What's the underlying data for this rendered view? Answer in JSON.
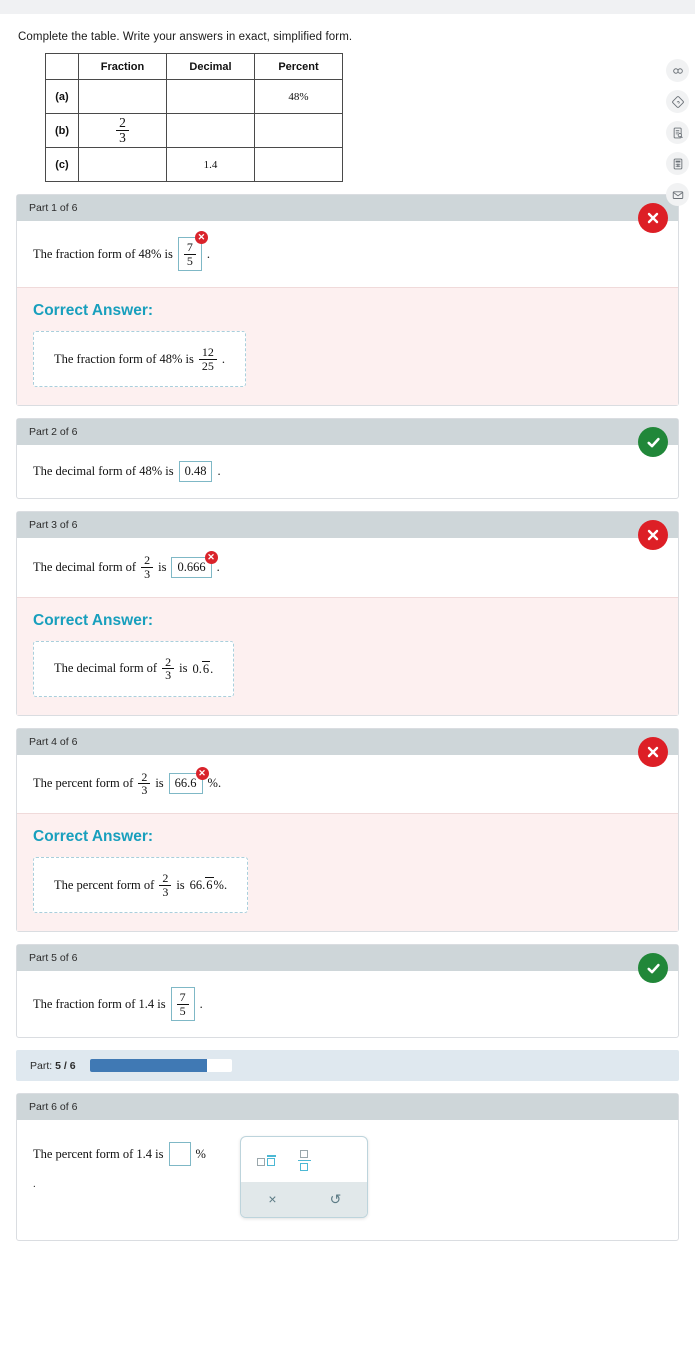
{
  "prompt": "Complete the table. Write your answers in exact, simplified form.",
  "table": {
    "headers": [
      "",
      "Fraction",
      "Decimal",
      "Percent"
    ],
    "rows": [
      {
        "label": "(a)",
        "fraction": "",
        "decimal": "",
        "percent": "48%"
      },
      {
        "label": "(b)",
        "fraction_num": "2",
        "fraction_den": "3",
        "decimal": "",
        "percent": ""
      },
      {
        "label": "(c)",
        "fraction": "",
        "decimal": "1.4",
        "percent": ""
      }
    ]
  },
  "parts": [
    {
      "header": "Part 1 of 6",
      "status": "incorrect",
      "statement_prefix": "The fraction form of 48% is",
      "statement_suffix": ".",
      "answer_num": "7",
      "answer_den": "5",
      "correct_title": "Correct Answer:",
      "correct_prefix": "The fraction form of 48% is",
      "correct_num": "12",
      "correct_den": "25",
      "correct_suffix": "."
    },
    {
      "header": "Part 2 of 6",
      "status": "correct",
      "statement_prefix": "The decimal form of 48% is",
      "statement_suffix": ".",
      "answer_value": "0.48"
    },
    {
      "header": "Part 3 of 6",
      "status": "incorrect",
      "statement_prefix": "The decimal form of",
      "statement_mid": "is",
      "frac_num": "2",
      "frac_den": "3",
      "statement_suffix": ".",
      "answer_value": "0.666",
      "correct_title": "Correct Answer:",
      "correct_prefix": "The decimal form of",
      "correct_mid": "is",
      "correct_lead": "0.",
      "correct_repeat": "6",
      "correct_suffix": "."
    },
    {
      "header": "Part 4 of 6",
      "status": "incorrect",
      "statement_prefix": "The percent form of",
      "statement_mid": "is",
      "frac_num": "2",
      "frac_den": "3",
      "statement_suffix": "%.",
      "answer_value": "66.6",
      "correct_title": "Correct Answer:",
      "correct_prefix": "The percent form of",
      "correct_mid": "is",
      "correct_lead": "66.",
      "correct_repeat": "6",
      "correct_suffix": "%."
    },
    {
      "header": "Part 5 of 6",
      "status": "correct",
      "statement_prefix": "The fraction form of 1.4 is",
      "statement_suffix": ".",
      "answer_num": "7",
      "answer_den": "5"
    },
    {
      "header": "Part 6 of 6",
      "status": "none",
      "statement_prefix": "The percent form of 1.4 is",
      "statement_suffix": "%",
      "answer_value": "",
      "trailing_dot": "."
    }
  ],
  "progress": {
    "label_prefix": "Part:",
    "current": "5 / 6",
    "percent": 83,
    "fill_color": "#4079b4"
  },
  "mathpad": {
    "keys": [
      {
        "name": "repeating-decimal-key",
        "label": "repeating-decimal-template"
      },
      {
        "name": "fraction-key",
        "label": "fraction-template"
      }
    ],
    "close_label": "×",
    "undo_label": "↺"
  },
  "rail": [
    {
      "name": "infinity-icon",
      "label": "infinity"
    },
    {
      "name": "diamond-tag-icon",
      "label": "reference"
    },
    {
      "name": "document-search-icon",
      "label": "document"
    },
    {
      "name": "calculator-icon",
      "label": "calculator"
    },
    {
      "name": "envelope-icon",
      "label": "message"
    }
  ],
  "colors": {
    "correct_green": "#218739",
    "incorrect_red": "#dd1f26",
    "accent_teal": "#189fbd",
    "header_gray": "#ced6d9",
    "progress_blue": "#4079b4"
  }
}
